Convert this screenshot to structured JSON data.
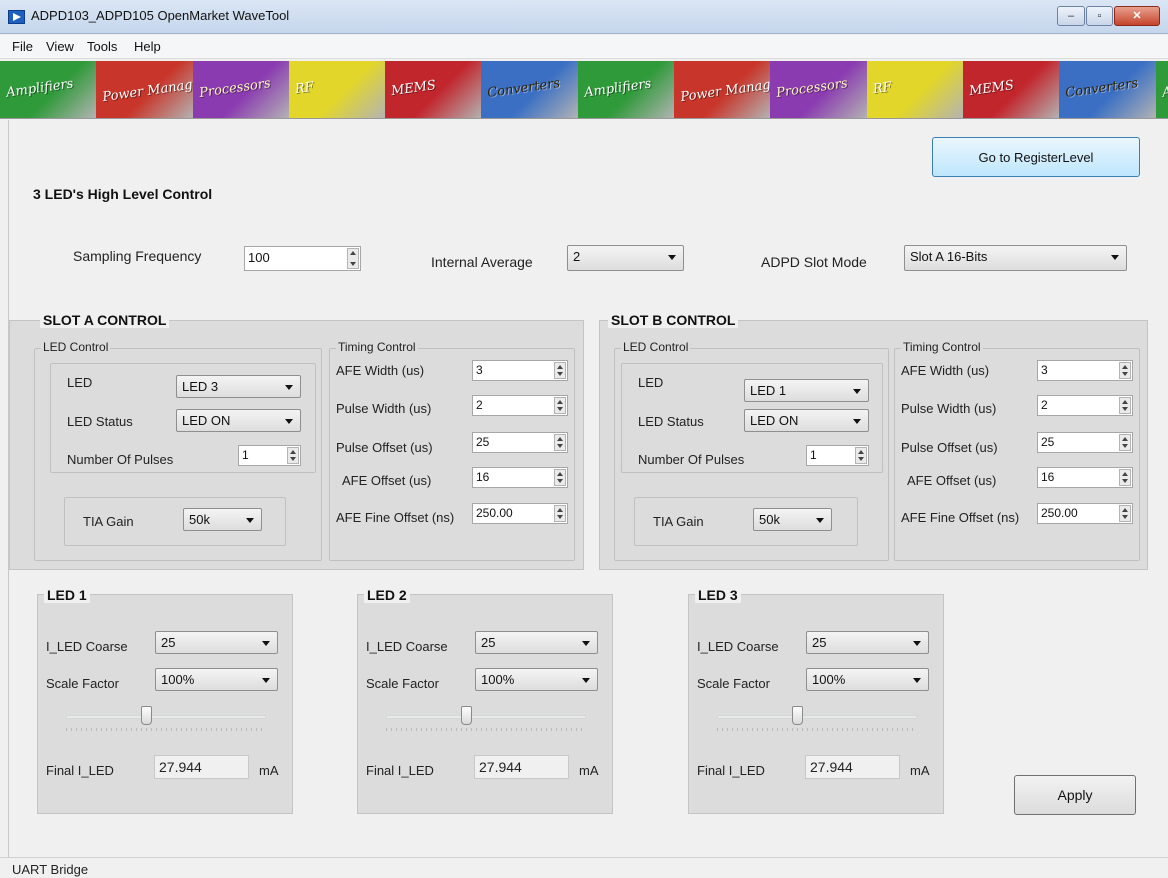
{
  "window": {
    "title": "ADPD103_ADPD105 OpenMarket WaveTool",
    "min_glyph": "–",
    "max_glyph": "▫",
    "close_glyph": "✕"
  },
  "menu": [
    "File",
    "View",
    "Tools",
    "Help"
  ],
  "banner": [
    "Amplifiers",
    "Power Management",
    "Processors",
    "RF",
    "MEMS",
    "Converters",
    "Amplifiers",
    "Power Management",
    "Processors",
    "RF",
    "MEMS",
    "Converters",
    "Amplifiers"
  ],
  "go_button": "Go to RegisterLevel",
  "section_title": "3 LED's High Level Control",
  "top": {
    "sampling_label": "Sampling Frequency",
    "sampling_value": "100",
    "average_label": "Internal Average",
    "average_value": "2",
    "slot_mode_label": "ADPD Slot Mode",
    "slot_mode_value": "Slot A 16-Bits"
  },
  "slots": [
    {
      "title": "SLOT A CONTROL",
      "led_control_title": "LED Control",
      "led_label": "LED",
      "led_value": "LED 3",
      "status_label": "LED Status",
      "status_value": "LED ON",
      "pulses_label": "Number Of Pulses",
      "pulses_value": "1",
      "tia_label": "TIA Gain",
      "tia_value": "50k",
      "timing_title": "Timing Control",
      "afe_width_label": "AFE Width (us)",
      "afe_width_value": "3",
      "pulse_width_label": "Pulse Width (us)",
      "pulse_width_value": "2",
      "pulse_offset_label": "Pulse Offset (us)",
      "pulse_offset_value": "25",
      "afe_offset_label": "AFE Offset (us)",
      "afe_offset_value": "16",
      "afe_fine_label": "AFE Fine Offset (ns)",
      "afe_fine_value": "250.00"
    },
    {
      "title": "SLOT B CONTROL",
      "led_control_title": "LED Control",
      "led_label": "LED",
      "led_value": "LED 1",
      "status_label": "LED Status",
      "status_value": "LED ON",
      "pulses_label": "Number Of Pulses",
      "pulses_value": "1",
      "tia_label": "TIA Gain",
      "tia_value": "50k",
      "timing_title": "Timing Control",
      "afe_width_label": "AFE Width (us)",
      "afe_width_value": "3",
      "pulse_width_label": "Pulse Width (us)",
      "pulse_width_value": "2",
      "pulse_offset_label": "Pulse Offset (us)",
      "pulse_offset_value": "25",
      "afe_offset_label": "AFE Offset (us)",
      "afe_offset_value": "16",
      "afe_fine_label": "AFE Fine Offset (ns)",
      "afe_fine_value": "250.00"
    }
  ],
  "leds": [
    {
      "title": "LED 1",
      "coarse_label": "I_LED Coarse",
      "coarse_value": "25",
      "scale_label": "Scale Factor",
      "scale_value": "100%",
      "slider_position": 0.4,
      "final_label": "Final I_LED",
      "final_value": "27.944",
      "unit": "mA"
    },
    {
      "title": "LED 2",
      "coarse_label": "I_LED Coarse",
      "coarse_value": "25",
      "scale_label": "Scale Factor",
      "scale_value": "100%",
      "slider_position": 0.4,
      "final_label": "Final I_LED",
      "final_value": "27.944",
      "unit": "mA"
    },
    {
      "title": "LED 3",
      "coarse_label": "I_LED Coarse",
      "coarse_value": "25",
      "scale_label": "Scale Factor",
      "scale_value": "100%",
      "slider_position": 0.4,
      "final_label": "Final I_LED",
      "final_value": "27.944",
      "unit": "mA"
    }
  ],
  "apply_button": "Apply",
  "status_bar": "UART Bridge",
  "colors": {
    "banner": [
      "#2f9a3a",
      "#c8362b",
      "#8a3bb0",
      "#e2d62a",
      "#c2262d",
      "#3a6fc4"
    ]
  }
}
